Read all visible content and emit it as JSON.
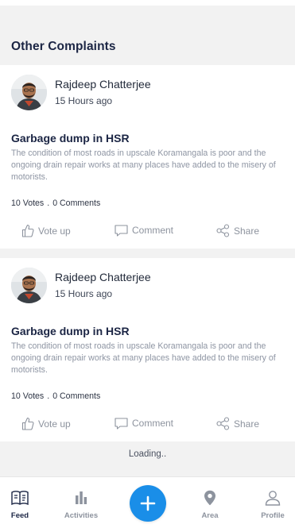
{
  "section": {
    "title": "Other Complaints"
  },
  "complaints": [
    {
      "author": "Rajdeep Chatterjee",
      "time": "15 Hours ago",
      "title": "Garbage dump in HSR",
      "body": "The condition of most roads in upscale Koramangala is poor and the ongoing drain repair works at many places have added to the misery of motorists.",
      "votes": "10 Votes",
      "separator": ".",
      "comments": "0 Comments",
      "actions": {
        "vote": "Vote up",
        "comment": "Comment",
        "share": "Share"
      }
    },
    {
      "author": "Rajdeep Chatterjee",
      "time": "15 Hours ago",
      "title": "Garbage dump in HSR",
      "body": "The condition of most roads in upscale Koramangala is poor and the ongoing drain repair works at many places have added to the misery of motorists.",
      "votes": "10 Votes",
      "separator": ".",
      "comments": "0 Comments",
      "actions": {
        "vote": "Vote up",
        "comment": "Comment",
        "share": "Share"
      }
    }
  ],
  "loading": "Loading..",
  "nav": {
    "feed": "Feed",
    "activities": "Activities",
    "area": "Area",
    "profile": "Profile",
    "active": "feed"
  },
  "colors": {
    "accent": "#1a8ee8",
    "title": "#1b2544",
    "muted": "#8d939e",
    "background": "#f2f2f2"
  },
  "icons": {
    "vote": "thumbs-up-icon",
    "comment": "comment-icon",
    "share": "share-icon",
    "feed": "feed-icon",
    "activities": "bar-chart-icon",
    "add": "plus-icon",
    "area": "location-pin-icon",
    "profile": "user-icon"
  }
}
